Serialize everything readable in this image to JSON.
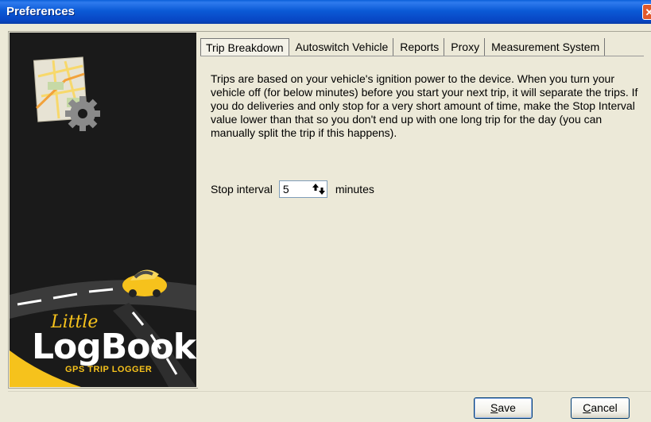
{
  "window": {
    "title": "Preferences",
    "close_label": "✕"
  },
  "tabs": [
    {
      "label": "Trip Breakdown",
      "active": true
    },
    {
      "label": "Autoswitch Vehicle",
      "active": false
    },
    {
      "label": "Reports",
      "active": false
    },
    {
      "label": "Proxy",
      "active": false
    },
    {
      "label": "Measurement System",
      "active": false
    }
  ],
  "trip_breakdown": {
    "description": "Trips are based on your vehicle's ignition power to the device. When you turn your vehicle off (for below minutes) before you start your next trip, it will separate the trips. If you do deliveries and only stop for a very short amount of time, make the Stop Interval value lower than that so you don't end up with one long trip for the day (you can manually split the trip if this happens).",
    "stop_interval_label": "Stop interval",
    "stop_interval_value": "5",
    "stop_interval_unit": "minutes"
  },
  "branding": {
    "little": "Little",
    "logbook": "LogBook",
    "tagline": "GPS TRIP LOGGER",
    "accent_color": "#f6c21c"
  },
  "buttons": {
    "save": {
      "accel": "S",
      "rest": "ave"
    },
    "cancel": {
      "accel": "C",
      "rest": "ancel"
    }
  }
}
